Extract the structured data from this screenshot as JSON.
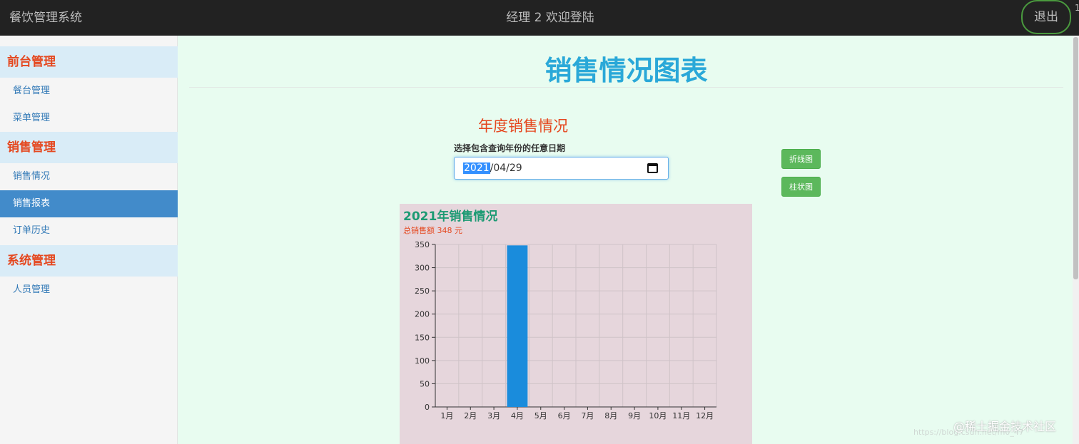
{
  "header": {
    "brand": "餐饮管理系统",
    "welcome": "经理  2  欢迎登陆",
    "logout_label": "退出"
  },
  "sidebar": {
    "sections": [
      {
        "title": "前台管理",
        "items": [
          "餐台管理",
          "菜单管理"
        ]
      },
      {
        "title": "销售管理",
        "items": [
          "销售情况",
          "销售报表",
          "订单历史"
        ]
      },
      {
        "title": "系统管理",
        "items": [
          "人员管理"
        ]
      }
    ],
    "active_item": "销售报表"
  },
  "main": {
    "page_title": "销售情况图表",
    "subtitle": "年度销售情况",
    "date_label": "选择包含查询年份的任意日期",
    "date_value_year": "2021",
    "date_value_rest": "/04/29",
    "buttons": {
      "line": "折线图",
      "bar": "柱状图"
    }
  },
  "chart_card": {
    "title": "2021年销售情况",
    "total_text": "总销售额 348 元"
  },
  "chart_data": {
    "type": "bar",
    "categories": [
      "1月",
      "2月",
      "3月",
      "4月",
      "5月",
      "6月",
      "7月",
      "8月",
      "9月",
      "10月",
      "11月",
      "12月"
    ],
    "values": [
      0,
      0,
      0,
      348,
      0,
      0,
      0,
      0,
      0,
      0,
      0,
      0
    ],
    "ylim": [
      0,
      350
    ],
    "yticks": [
      0,
      50,
      100,
      150,
      200,
      250,
      300,
      350
    ],
    "grid": true,
    "bar_color": "#1a8cdc"
  },
  "colors": {
    "accent_blue": "#2aa8d8",
    "section_red": "#e5471e",
    "button_green": "#5cb85c",
    "active_item_bg": "#428bca"
  },
  "watermark": {
    "text": "@稀土掘金技术社区",
    "url": "https://blog.csdn.net/m0_47"
  }
}
